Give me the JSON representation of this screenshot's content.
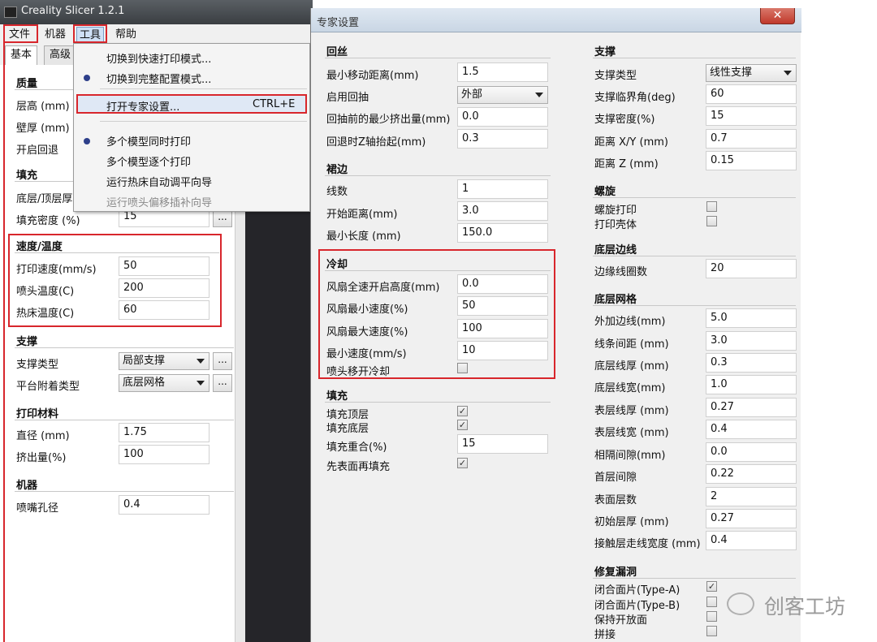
{
  "app": {
    "title": "Creality Slicer 1.2.1"
  },
  "menubar": {
    "file": "文件",
    "machine": "机器",
    "tools": "工具",
    "help": "帮助"
  },
  "tabs": {
    "basic": "基本",
    "advanced": "高级"
  },
  "tools_menu": {
    "item1": "切换到快速打印模式...",
    "item2": "切换到完整配置模式...",
    "item3": "打开专家设置...",
    "item3_shortcut": "CTRL+E",
    "item4": "多个模型同时打印",
    "item5": "多个模型逐个打印",
    "item6": "运行热床自动调平向导",
    "item7": "运行喷头偏移插补向导"
  },
  "basic": {
    "quality": {
      "title": "质量",
      "layer_height": "层高 (mm)",
      "wall": "壁厚 (mm)",
      "retract": "开启回退"
    },
    "fill": {
      "title": "填充",
      "tb_thickness": "底层/顶层厚",
      "density": "填充密度 (%)",
      "density_val": "15"
    },
    "speed": {
      "title": "速度/温度",
      "print_speed": "打印速度(mm/s)",
      "print_speed_val": "50",
      "nozzle_temp": "喷头温度(C)",
      "nozzle_temp_val": "200",
      "bed_temp": "热床温度(C)",
      "bed_temp_val": "60"
    },
    "support": {
      "title": "支撑",
      "type": "支撑类型",
      "type_val": "局部支撑",
      "adhesion": "平台附着类型",
      "adhesion_val": "底层网格",
      "more": "..."
    },
    "material": {
      "title": "打印材料",
      "diameter": "直径 (mm)",
      "diameter_val": "1.75",
      "flow": "挤出量(%)",
      "flow_val": "100"
    },
    "machine": {
      "title": "机器",
      "nozzle": "喷嘴孔径",
      "nozzle_val": "0.4"
    }
  },
  "expert": {
    "title": "专家设置",
    "close": "✕",
    "retraction": {
      "title": "回丝",
      "min_travel": "最小移动距离(mm)",
      "min_travel_val": "1.5",
      "enable": "启用回抽",
      "enable_val": "外部",
      "min_extrude": "回抽前的最少挤出量(mm)",
      "min_extrude_val": "0.0",
      "z_hop": "回退时Z轴抬起(mm)",
      "z_hop_val": "0.3"
    },
    "skirt": {
      "title": "裙边",
      "lines": "线数",
      "lines_val": "1",
      "start_dist": "开始距离(mm)",
      "start_dist_val": "3.0",
      "min_len": "最小长度 (mm)",
      "min_len_val": "150.0"
    },
    "cool": {
      "title": "冷却",
      "fan_full": "风扇全速开启高度(mm)",
      "fan_full_val": "0.0",
      "fan_min": "风扇最小速度(%)",
      "fan_min_val": "50",
      "fan_max": "风扇最大速度(%)",
      "fan_max_val": "100",
      "min_speed": "最小速度(mm/s)",
      "min_speed_val": "10",
      "head_lift": "喷头移开冷却"
    },
    "infill": {
      "title": "填充",
      "top": "填充顶层",
      "bottom": "填充底层",
      "overlap": "填充重合(%)",
      "overlap_val": "15",
      "surface_first": "先表面再填充"
    },
    "support": {
      "title": "支撑",
      "type": "支撑类型",
      "type_val": "线性支撑",
      "angle": "支撑临界角(deg)",
      "angle_val": "60",
      "density": "支撑密度(%)",
      "density_val": "15",
      "xy": "距离 X/Y (mm)",
      "xy_val": "0.7",
      "z": "距离 Z (mm)",
      "z_val": "0.15"
    },
    "spiral": {
      "title": "螺旋",
      "spiral": "螺旋打印",
      "shell": "打印壳体"
    },
    "brim": {
      "title": "底层边线",
      "loops": "边缘线圈数",
      "loops_val": "20"
    },
    "raft": {
      "title": "底层网格",
      "margin": "外加边线(mm)",
      "margin_val": "5.0",
      "line_spacing": "线条间距 (mm)",
      "line_spacing_val": "3.0",
      "base_thick": "底层线厚 (mm)",
      "base_thick_val": "0.3",
      "base_width": "底层线宽(mm)",
      "base_width_val": "1.0",
      "iface_thick": "表层线厚 (mm)",
      "iface_thick_val": "0.27",
      "iface_width": "表层线宽 (mm)",
      "iface_width_val": "0.4",
      "air_gap": "相隔间隙(mm)",
      "air_gap_val": "0.0",
      "first_gap": "首层间隙",
      "first_gap_val": "0.22",
      "surface_layers": "表面层数",
      "surface_layers_val": "2",
      "init_thick": "初始层厚 (mm)",
      "init_thick_val": "0.27",
      "contact_width": "接触层走线宽度 (mm)",
      "contact_width_val": "0.4"
    },
    "fix": {
      "title": "修复漏洞",
      "close_a": "闭合面片(Type-A)",
      "close_b": "闭合面片(Type-B)",
      "keep_open": "保持开放面",
      "stitch": "拼接"
    }
  },
  "watermark": "创客工坊",
  "check_mark": "✓"
}
